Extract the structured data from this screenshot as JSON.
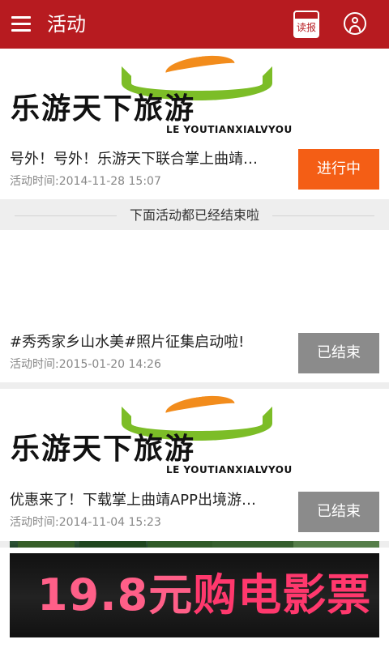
{
  "app": {
    "title": "活动",
    "newspaper_label": "读报"
  },
  "brand_banner": {
    "chinese_name": "乐游天下旅游",
    "english_name": "LE YOUTIANXIALVYOU"
  },
  "events": {
    "active": {
      "title": "号外！号外！乐游天下联合掌上曲靖…",
      "time": "活动时间:2014-11-28 15:07",
      "status": "进行中"
    },
    "ended_notice": "下面活动都已经结束啦",
    "ended": [
      {
        "title": "#秀秀家乡山水美#照片征集启动啦!",
        "time": "活动时间:2015-01-20 14:26",
        "status": "已结束"
      },
      {
        "title": "优惠来了！下载掌上曲靖APP出境游…",
        "time": "活动时间:2014-11-04 15:23",
        "status": "已结束"
      }
    ]
  },
  "promo": {
    "price_text": "19.8元",
    "slogan": "购电影票"
  },
  "colors": {
    "app_bar": "#b71b20",
    "active_status": "#f45e15",
    "ended_status": "#8b8b8b"
  },
  "icons": [
    "menu-icon",
    "newspaper-icon",
    "user-icon"
  ]
}
